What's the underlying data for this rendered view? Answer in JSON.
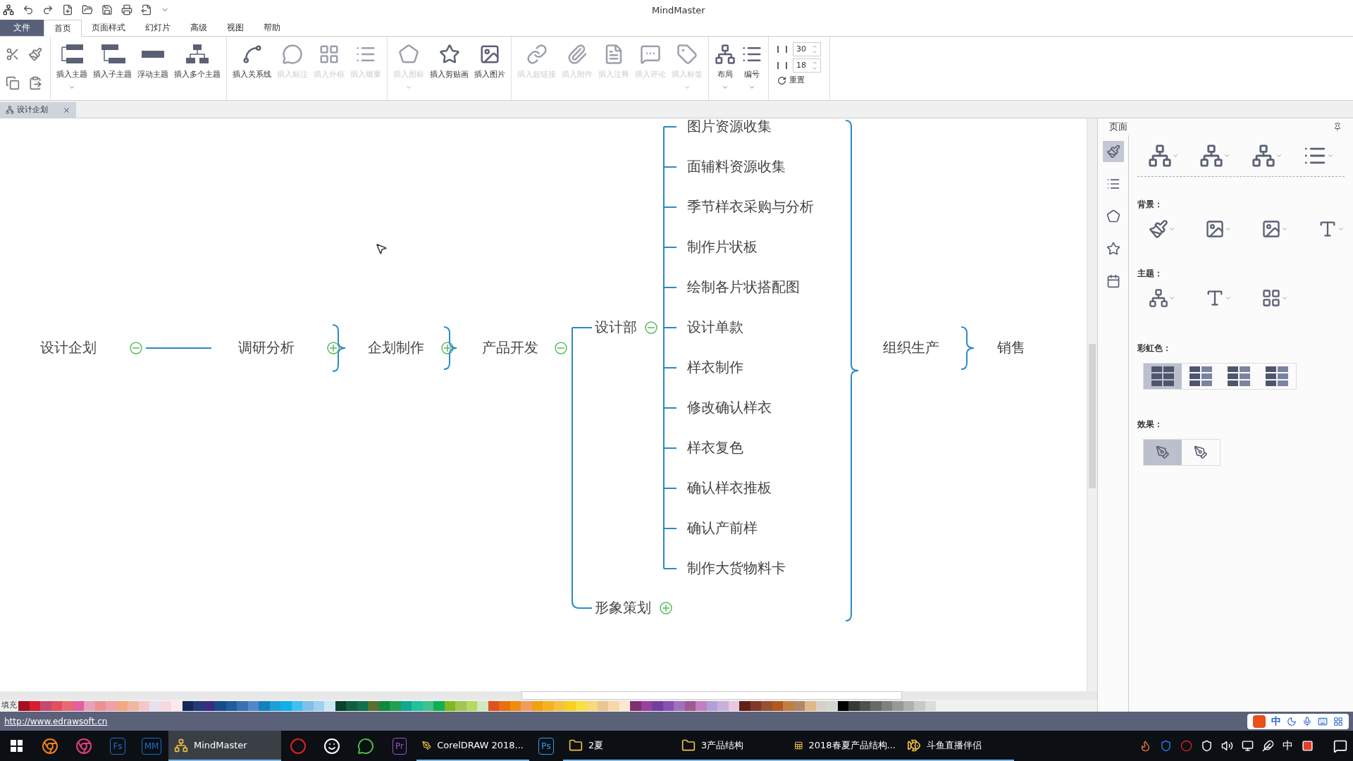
{
  "window": {
    "title": "MindMaster"
  },
  "file_button": {
    "label": "文件"
  },
  "menu_tabs": [
    {
      "label": "首页",
      "selected": true
    },
    {
      "label": "页面样式",
      "selected": false
    },
    {
      "label": "幻灯片",
      "selected": false
    },
    {
      "label": "高级",
      "selected": false
    },
    {
      "label": "视图",
      "selected": false
    },
    {
      "label": "帮助",
      "selected": false
    }
  ],
  "ribbon_groups": [
    [
      {
        "label": "插入主题",
        "disabled": false,
        "dropdown": true
      },
      {
        "label": "插入子主题",
        "disabled": false,
        "dropdown": false
      },
      {
        "label": "浮动主题",
        "disabled": false,
        "dropdown": false
      },
      {
        "label": "插入多个主题",
        "disabled": false,
        "dropdown": false
      }
    ],
    [
      {
        "label": "插入关系线",
        "disabled": false,
        "dropdown": false
      },
      {
        "label": "插入标注",
        "disabled": true,
        "dropdown": false
      },
      {
        "label": "插入外框",
        "disabled": true,
        "dropdown": false
      },
      {
        "label": "插入概要",
        "disabled": true,
        "dropdown": false
      }
    ],
    [
      {
        "label": "插入图标",
        "disabled": true,
        "dropdown": true
      },
      {
        "label": "插入剪贴画",
        "disabled": false,
        "dropdown": false
      },
      {
        "label": "插入图片",
        "disabled": false,
        "dropdown": false
      }
    ],
    [
      {
        "label": "插入超链接",
        "disabled": true,
        "dropdown": false
      },
      {
        "label": "插入附件",
        "disabled": true,
        "dropdown": false
      },
      {
        "label": "插入注释",
        "disabled": true,
        "dropdown": false
      },
      {
        "label": "插入评论",
        "disabled": true,
        "dropdown": false
      },
      {
        "label": "插入标签",
        "disabled": true,
        "dropdown": true
      }
    ],
    [
      {
        "label": "布局",
        "disabled": false,
        "dropdown": true
      },
      {
        "label": "编号",
        "disabled": false,
        "dropdown": true
      }
    ]
  ],
  "spacing": {
    "horizontal": "30",
    "vertical": "18",
    "reset": "重置"
  },
  "document_tab": {
    "label": "设计企划"
  },
  "mindmap": {
    "chain": [
      {
        "label": "设计企划",
        "expanded": true
      },
      {
        "label": "调研分析",
        "expanded": false
      },
      {
        "label": "企划制作",
        "expanded": false
      },
      {
        "label": "产品开发",
        "expanded": true,
        "children": [
          {
            "label": "设计部",
            "expanded": true,
            "children": [
              {
                "label": "图片资源收集"
              },
              {
                "label": "面辅料资源收集"
              },
              {
                "label": "季节样衣采购与分析"
              },
              {
                "label": "制作片状板"
              },
              {
                "label": "绘制各片状搭配图"
              },
              {
                "label": "设计单款"
              },
              {
                "label": "样衣制作"
              },
              {
                "label": "修改确认样衣"
              },
              {
                "label": "样衣复色"
              },
              {
                "label": "确认样衣推板"
              },
              {
                "label": "确认产前样"
              },
              {
                "label": "制作大货物料卡"
              }
            ]
          },
          {
            "label": "形象策划",
            "expanded": false
          }
        ]
      },
      {
        "label": "组织生产"
      },
      {
        "label": "销售"
      }
    ]
  },
  "side_panel": {
    "title": "页面",
    "tools": [
      {
        "selected": true
      },
      {
        "selected": false
      },
      {
        "selected": false
      },
      {
        "selected": false
      },
      {
        "selected": false
      }
    ],
    "sections": [
      {
        "label": "背景："
      },
      {
        "label": "主题："
      },
      {
        "label": "彩虹色：",
        "options": [
          {
            "selected": true
          },
          {
            "selected": false
          },
          {
            "selected": false
          },
          {
            "selected": false
          }
        ]
      },
      {
        "label": "效果：",
        "options": [
          {
            "selected": true
          },
          {
            "selected": false
          }
        ]
      }
    ]
  },
  "palette": {
    "label": "填充",
    "swatches": [
      {
        "color": "#a5101e"
      },
      {
        "color": "#d31f2e"
      },
      {
        "color": "#c24a72"
      },
      {
        "color": "#e0505c"
      },
      {
        "color": "#e86a70"
      },
      {
        "color": "#e060a0"
      },
      {
        "color": "#e8a0b8"
      },
      {
        "color": "#ee9090"
      },
      {
        "color": "#f0a0a8"
      },
      {
        "color": "#f4a880"
      },
      {
        "color": "#f0b8a0"
      },
      {
        "color": "#f4c8c8"
      },
      {
        "color": "#e8e0f0"
      },
      {
        "color": "#f8d8e0"
      },
      {
        "color": "#fde8ec"
      },
      {
        "color": "#14285a"
      },
      {
        "color": "#243a78"
      },
      {
        "color": "#3a2c80"
      },
      {
        "color": "#164c8c"
      },
      {
        "color": "#1c5ea0"
      },
      {
        "color": "#3870b8"
      },
      {
        "color": "#5088c8"
      },
      {
        "color": "#1480c0"
      },
      {
        "color": "#1ca0d8"
      },
      {
        "color": "#10b0e8"
      },
      {
        "color": "#40c0f0"
      },
      {
        "color": "#80c0e8"
      },
      {
        "color": "#a0d0f0"
      },
      {
        "color": "#c8e8f4"
      },
      {
        "color": "#0c4030"
      },
      {
        "color": "#106040"
      },
      {
        "color": "#107050"
      },
      {
        "color": "#587030"
      },
      {
        "color": "#108840"
      },
      {
        "color": "#20a050"
      },
      {
        "color": "#10a890"
      },
      {
        "color": "#20c0a0"
      },
      {
        "color": "#40c090"
      },
      {
        "color": "#10b050"
      },
      {
        "color": "#80b820"
      },
      {
        "color": "#a0c850"
      },
      {
        "color": "#b8d860"
      },
      {
        "color": "#d0e8c0"
      },
      {
        "color": "#e05020"
      },
      {
        "color": "#e87010"
      },
      {
        "color": "#f08c10"
      },
      {
        "color": "#f09c60"
      },
      {
        "color": "#f0a010"
      },
      {
        "color": "#f8b020"
      },
      {
        "color": "#f8c040"
      },
      {
        "color": "#f8d020"
      },
      {
        "color": "#f8e040"
      },
      {
        "color": "#f8d878"
      },
      {
        "color": "#e8c890"
      },
      {
        "color": "#f8d8a8"
      },
      {
        "color": "#fce8d0"
      },
      {
        "color": "#803070"
      },
      {
        "color": "#9840a0"
      },
      {
        "color": "#7040a0"
      },
      {
        "color": "#8850b0"
      },
      {
        "color": "#a070c0"
      },
      {
        "color": "#a05890"
      },
      {
        "color": "#c080c0"
      },
      {
        "color": "#b0a0d8"
      },
      {
        "color": "#c8b0d8"
      },
      {
        "color": "#e8c8e0"
      },
      {
        "color": "#602018"
      },
      {
        "color": "#803828"
      },
      {
        "color": "#985030"
      },
      {
        "color": "#b05820"
      },
      {
        "color": "#c08040"
      },
      {
        "color": "#b08868"
      },
      {
        "color": "#e0b888"
      },
      {
        "color": "#d8d0c8"
      },
      {
        "color": "#d0d8d0"
      },
      {
        "color": "#000000"
      },
      {
        "color": "#383838"
      },
      {
        "color": "#505050"
      },
      {
        "color": "#686868"
      },
      {
        "color": "#808080"
      },
      {
        "color": "#989898"
      },
      {
        "color": "#b0b0b0"
      },
      {
        "color": "#c8c8c8"
      },
      {
        "color": "#dcdcdc"
      }
    ]
  },
  "status_bar": {
    "link": "http://www.edrawsoft.cn"
  },
  "ime_bar": {
    "mode": "中"
  },
  "taskbar": {
    "items": [
      {
        "kind": "start"
      },
      {
        "kind": "icon"
      },
      {
        "kind": "icon"
      },
      {
        "kind": "badge",
        "badge": "Fs",
        "color": "#1c6ec8"
      },
      {
        "kind": "badge",
        "badge": "MM",
        "color": "#1c6ec8"
      },
      {
        "kind": "window",
        "label": "MindMaster",
        "selected": true
      },
      {
        "kind": "icon"
      },
      {
        "kind": "icon"
      },
      {
        "kind": "icon"
      },
      {
        "kind": "badge",
        "badge": "Pr",
        "color": "#9a50d0"
      },
      {
        "kind": "window",
        "label": "CorelDRAW 2018...",
        "selected": false
      },
      {
        "kind": "badge",
        "badge": "Ps",
        "color": "#2ea0e8"
      },
      {
        "kind": "window",
        "label": "2夏",
        "selected": false
      },
      {
        "kind": "window",
        "label": "3产品结构",
        "selected": false
      },
      {
        "kind": "window",
        "label": "2018春夏产品结构...",
        "selected": false
      },
      {
        "kind": "window",
        "label": "斗鱼直播伴侣",
        "selected": false
      }
    ],
    "tray_language": "中"
  }
}
